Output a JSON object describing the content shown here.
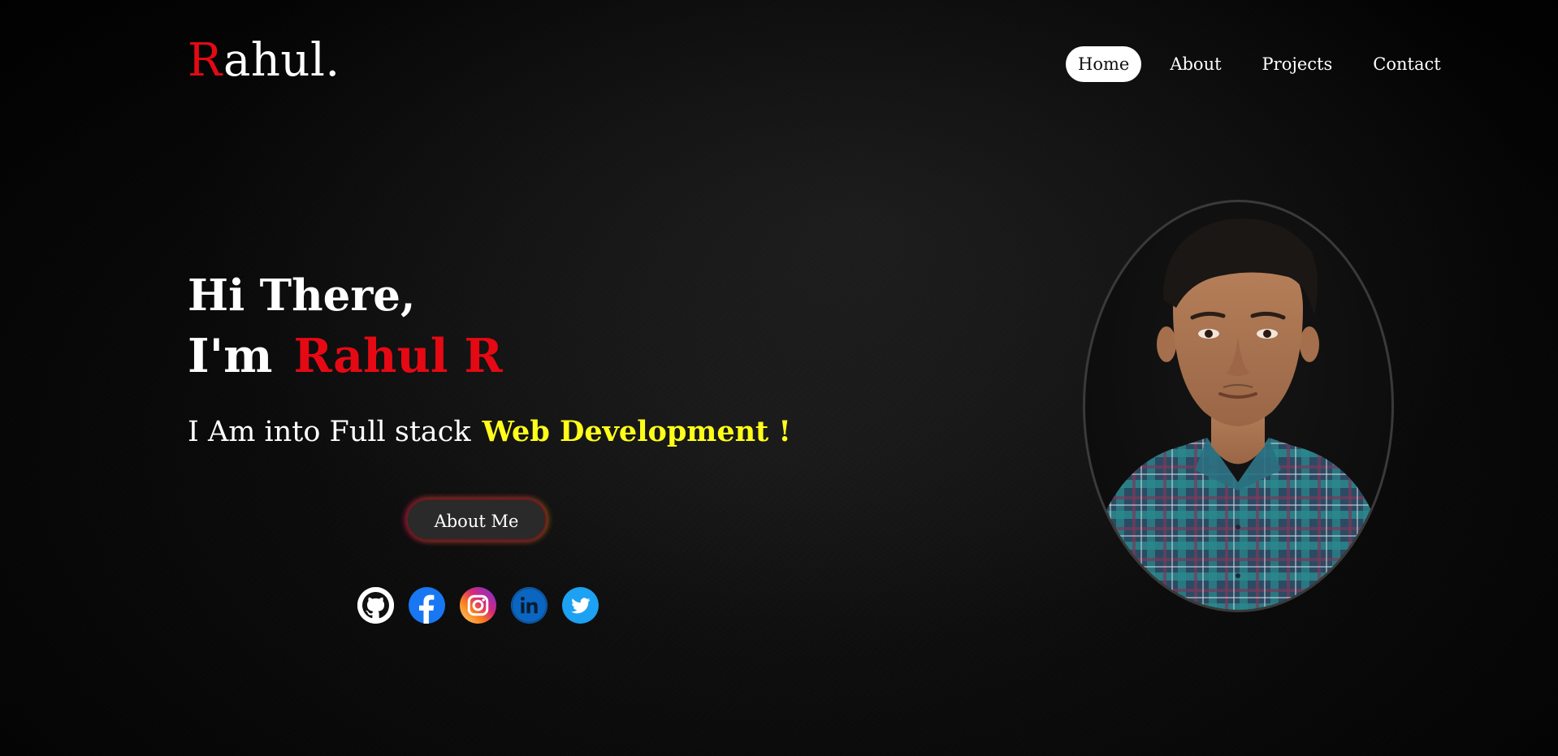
{
  "header": {
    "logo_initial": "R",
    "logo_rest": "ahul."
  },
  "nav": {
    "items": [
      {
        "label": "Home",
        "active": true
      },
      {
        "label": "About",
        "active": false
      },
      {
        "label": "Projects",
        "active": false
      },
      {
        "label": "Contact",
        "active": false
      }
    ]
  },
  "hero": {
    "greeting": "Hi There,",
    "iam_prefix": "I'm",
    "name": "Rahul R",
    "tagline_prefix": "I Am into Full stack",
    "tagline_highlight": "Web Development !",
    "cta_label": "About Me"
  },
  "socials": [
    {
      "icon": "github-icon",
      "color": "#ffffff"
    },
    {
      "icon": "facebook-icon",
      "color": "#1877f2"
    },
    {
      "icon": "instagram-icon",
      "color": "#e1306c"
    },
    {
      "icon": "linkedin-icon",
      "color": "#0a66c2"
    },
    {
      "icon": "twitter-icon",
      "color": "#1da1f2"
    }
  ],
  "colors": {
    "accent_red": "#e50914",
    "highlight_yellow": "#ffff1a",
    "background": "#0b0b0b"
  },
  "portrait": {
    "icon": "profile-photo"
  }
}
